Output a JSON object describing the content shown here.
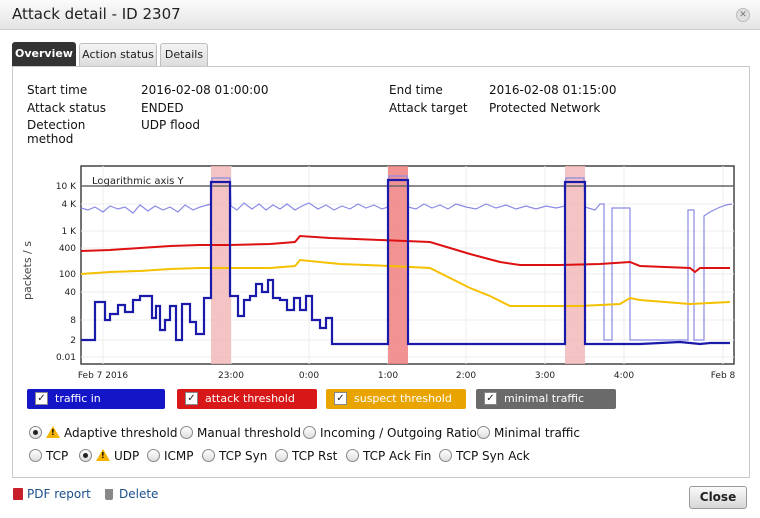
{
  "window": {
    "title": "Attack detail - ID 2307"
  },
  "tabs": [
    "Overview",
    "Action status",
    "Details"
  ],
  "details": {
    "start_time_label": "Start time",
    "start_time": "2016-02-08 01:00:00",
    "end_time_label": "End time",
    "end_time": "2016-02-08 01:15:00",
    "status_label": "Attack status",
    "status": "ENDED",
    "target_label": "Attack target",
    "target": "Protected Network",
    "method_label_1": "Detection",
    "method_label_2": "method",
    "method": "UDP flood"
  },
  "chart_data": {
    "type": "line",
    "annotation": "Logarithmic axis Y",
    "ylabel": "packets / s",
    "y_scale": "log",
    "y_ticks": [
      "10 K",
      "4 K",
      "1 K",
      "400",
      "100",
      "40",
      "8",
      "2",
      "0.01"
    ],
    "x_ticks": [
      "Feb 7 2016",
      "23:00",
      "0:00",
      "1:00",
      "2:00",
      "3:00",
      "4:00",
      "Feb 8"
    ],
    "series": [
      {
        "name": "traffic in",
        "color": "#1a1aaa"
      },
      {
        "name": "attack threshold",
        "color": "#dd1111"
      },
      {
        "name": "suspect threshold",
        "color": "#f5c000"
      },
      {
        "name": "minimal traffic",
        "color": "#666666"
      }
    ]
  },
  "legend": [
    "traffic in",
    "attack threshold",
    "suspect threshold",
    "minimal traffic"
  ],
  "threshold_options": [
    "Adaptive threshold",
    "Manual threshold",
    "Incoming / Outgoing Ratio",
    "Minimal traffic"
  ],
  "protocol_options": [
    "TCP",
    "UDP",
    "ICMP",
    "TCP Syn",
    "TCP Rst",
    "TCP Ack Fin",
    "TCP Syn Ack"
  ],
  "footer": {
    "pdf": "PDF report",
    "delete": "Delete",
    "close": "Close"
  }
}
